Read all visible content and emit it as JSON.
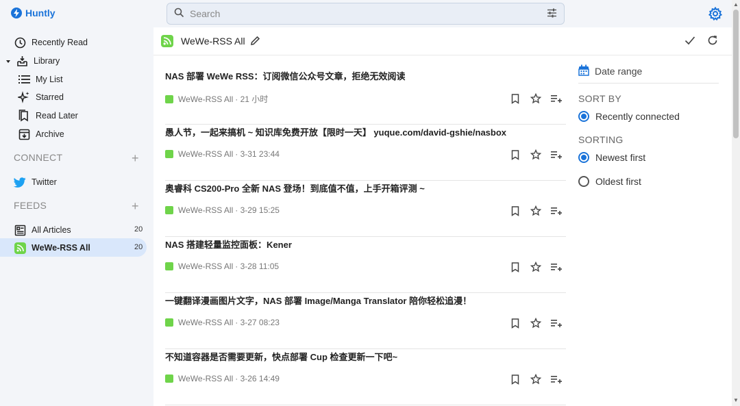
{
  "app": {
    "name": "Huntly"
  },
  "search": {
    "placeholder": "Search"
  },
  "sidebar": {
    "items": [
      {
        "label": "Recently Read"
      },
      {
        "label": "Library"
      },
      {
        "label": "My List"
      },
      {
        "label": "Starred"
      },
      {
        "label": "Read Later"
      },
      {
        "label": "Archive"
      }
    ],
    "connect": {
      "title": "CONNECT",
      "items": [
        {
          "label": "Twitter"
        }
      ]
    },
    "feeds": {
      "title": "FEEDS",
      "items": [
        {
          "label": "All Articles",
          "count": "20"
        },
        {
          "label": "WeWe-RSS All",
          "count": "20"
        }
      ]
    }
  },
  "main": {
    "title": "WeWe-RSS All",
    "articles": [
      {
        "title": "NAS 部署 WeWe RSS：订阅微信公众号文章，拒绝无效阅读",
        "source": "WeWe-RSS All",
        "time": "· 21 小时"
      },
      {
        "title": "愚人节，一起来搞机 ~ 知识库免费开放【限时一天】 yuque.com/david-gshie/nasbox",
        "source": "WeWe-RSS All",
        "time": "· 3-31 23:44"
      },
      {
        "title": "奥睿科 CS200-Pro 全新 NAS 登场！到底值不值，上手开箱评测 ~",
        "source": "WeWe-RSS All",
        "time": "· 3-29 15:25"
      },
      {
        "title": "NAS 搭建轻量监控面板：Kener",
        "source": "WeWe-RSS All",
        "time": "· 3-28 11:05"
      },
      {
        "title": "一键翻译漫画图片文字，NAS 部署 Image/Manga Translator 陪你轻松追漫！",
        "source": "WeWe-RSS All",
        "time": "· 3-27 08:23"
      },
      {
        "title": "不知道容器是否需要更新，快点部署 Cup 检查更新一下吧~",
        "source": "WeWe-RSS All",
        "time": "· 3-26 14:49"
      }
    ]
  },
  "filters": {
    "date_range": "Date range",
    "sort_by": {
      "title": "SORT BY",
      "options": [
        {
          "label": "Recently connected",
          "selected": true
        }
      ]
    },
    "sorting": {
      "title": "SORTING",
      "options": [
        {
          "label": "Newest first",
          "selected": true
        },
        {
          "label": "Oldest first",
          "selected": false
        }
      ]
    }
  },
  "colors": {
    "accent": "#1a73d9",
    "feed_icon": "#6fd44a",
    "active_bg": "#d9e7fb"
  }
}
